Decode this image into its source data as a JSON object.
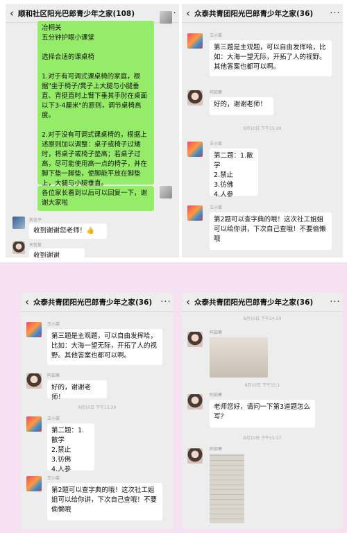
{
  "panel1": {
    "title": "顺和社区阳光巴郎青少年之家(108)",
    "green_msg": "冶桐关\n五分钟护眼小课堂\n\n选择合适的课桌椅\n\n1.对于有可调式课桌椅的家庭，根据\"坐于椅子/凳子上大腿与小腿垂直、背挺直时上臂下垂其手肘在桌面以下3-4厘米\"的原则，调节桌椅高度。\n\n2.对于没有可调式课桌椅的，根据上述原则加以调整：桌子或椅子过矮时，将桌子或椅子垫高；若桌子过高，尽可能使用高一点的椅子，并在脚下垫一脚垫，使脚能平放在脚垫上，大腿与小腿垂直。",
    "green_msg2": "各位家长看到以后可以回复一下，谢谢大家啦",
    "name1": "风信子",
    "reply1": "收到谢谢您老师！👍",
    "name2": "天忱草",
    "reply2": "收到谢谢"
  },
  "panel2": {
    "title": "众泰共青团阳光巴郎青少年之家(36)",
    "name_teacher": "王小菜",
    "msg1": "第三题是主观题，可以自由发挥哈，比如：大海一望无际，开拓了人的视野。其他答案也都可以啊。",
    "name_parent": "阿茹寒",
    "msg2": "好的，谢谢老师！",
    "time1": "8月10日 下午15:29",
    "msg3": "第二题：1.散学\n2.禁止\n3.彷佛\n4.人参",
    "msg4": "第2题可以查字典的哦！这次社工姐姐可以给你讲，下次自己查哦！不要偷懒哦"
  },
  "panel3": {
    "title": "众泰共青团阳光巴郎青少年之家(36)",
    "name_teacher": "王小菜",
    "msg1": "第三题是主观题，可以自由发挥哈，比如：大海一望无际，开拓了人的视野。其他答案也都可以啊。",
    "name_parent": "阿茹寒",
    "msg2": "好的，谢谢老师！",
    "time1": "8月10日 下午15:29",
    "msg3": "第二题：1.散学\n2.禁止\n3.彷佛\n4.人参",
    "msg4": "第2题可以查字典的哦！这次社工姐姐可以给你讲，下次自己查哦！不要偷懒哦"
  },
  "panel4": {
    "title": "众泰共青团阳光巴郎青少年之家(36)",
    "time1": "8月10日 下午14:59",
    "name_parent": "阿茹寒",
    "time2": "8月10日 下午15:1",
    "msg1": "老师您好，请问一下第3道题怎么写?",
    "time3": "8月10日 下午15:17"
  },
  "icons": {
    "back": "‹",
    "more": "···"
  }
}
